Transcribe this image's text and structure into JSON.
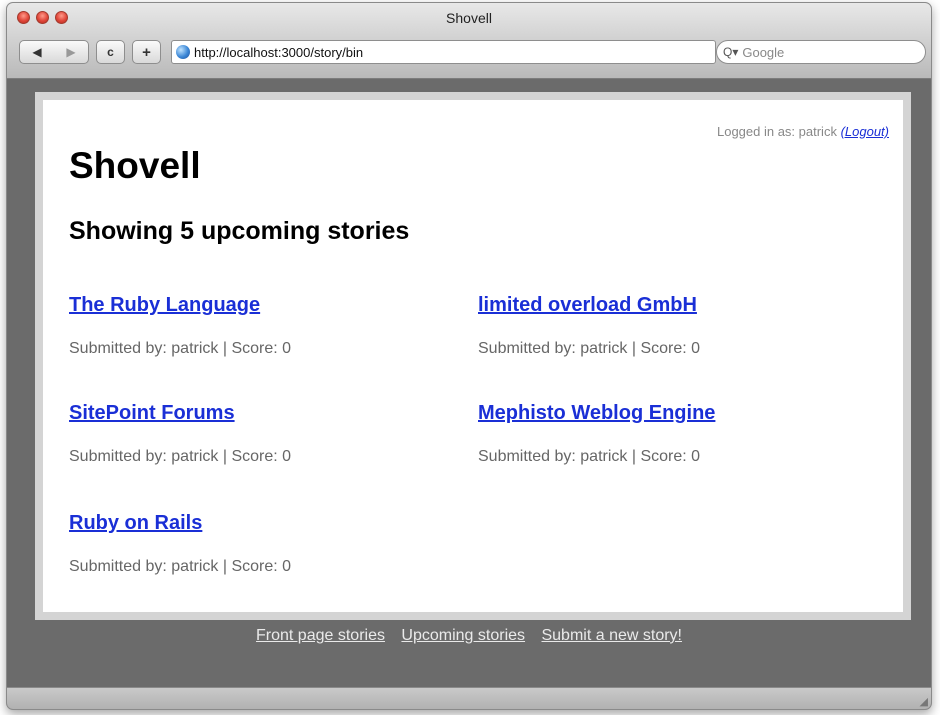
{
  "window": {
    "title": "Shovell"
  },
  "toolbar": {
    "back_icon": "◀",
    "forward_icon": "▶",
    "reload_icon": "c",
    "add_icon": "+",
    "url": "http://localhost:3000/story/bin",
    "search_placeholder": "Google",
    "search_icon": "Q▾"
  },
  "page": {
    "login_text": "Logged in as: patrick",
    "logout_label": "(Logout)",
    "site_title": "Shovell",
    "heading": "Showing 5 upcoming stories",
    "stories": [
      {
        "title": "The Ruby Language",
        "meta": "Submitted by: patrick | Score: 0"
      },
      {
        "title": "limited overload GmbH",
        "meta": "Submitted by: patrick | Score: 0"
      },
      {
        "title": "SitePoint Forums",
        "meta": "Submitted by: patrick | Score: 0"
      },
      {
        "title": "Mephisto Weblog Engine",
        "meta": "Submitted by: patrick | Score: 0"
      },
      {
        "title": "Ruby on Rails",
        "meta": "Submitted by: patrick | Score: 0"
      }
    ]
  },
  "footer": {
    "links": [
      "Front page stories",
      "Upcoming stories",
      "Submit a new story!"
    ]
  },
  "colors": {
    "link": "#1a2fd6",
    "meta_text": "#666666",
    "chrome_bg": "#6b6b6b"
  }
}
